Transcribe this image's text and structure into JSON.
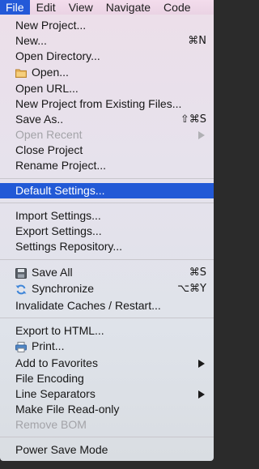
{
  "menubar": {
    "items": [
      "File",
      "Edit",
      "View",
      "Navigate",
      "Code"
    ]
  },
  "menu": {
    "new_project": "New Project...",
    "new": "New...",
    "new_shortcut": "⌘N",
    "open_directory": "Open Directory...",
    "open": "Open...",
    "open_url": "Open URL...",
    "new_from_existing": "New Project from Existing Files...",
    "save_as": "Save As..",
    "save_as_shortcut": "⇧⌘S",
    "open_recent": "Open Recent",
    "close_project": "Close Project",
    "rename_project": "Rename Project...",
    "default_settings": "Default Settings...",
    "import_settings": "Import Settings...",
    "export_settings": "Export Settings...",
    "settings_repository": "Settings Repository...",
    "save_all": "Save All",
    "save_all_shortcut": "⌘S",
    "synchronize": "Synchronize",
    "synchronize_shortcut": "⌥⌘Y",
    "invalidate_caches": "Invalidate Caches / Restart...",
    "export_html": "Export to HTML...",
    "print": "Print...",
    "add_favorites": "Add to Favorites",
    "file_encoding": "File Encoding",
    "line_separators": "Line Separators",
    "make_read_only": "Make File Read-only",
    "remove_bom": "Remove BOM",
    "power_save": "Power Save Mode"
  },
  "icons": {
    "open": "folder-icon",
    "save_all": "floppy-disk-icon",
    "synchronize": "sync-icon",
    "print": "printer-icon"
  },
  "colors": {
    "selection": "#2259d6",
    "active_menu": "#2359d8",
    "disabled_text": "#a3a3a8"
  }
}
